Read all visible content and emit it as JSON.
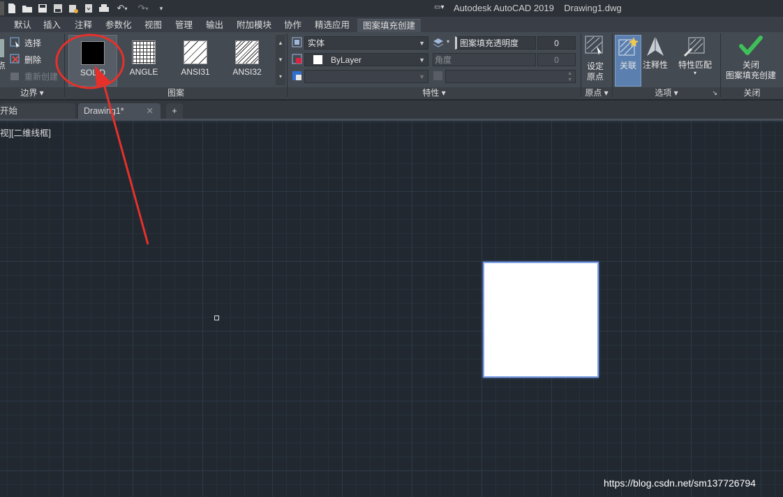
{
  "app_title": "Autodesk AutoCAD 2019    Drawing1.dwg",
  "ribbon_tabs": [
    "默认",
    "插入",
    "注释",
    "参数化",
    "视图",
    "管理",
    "输出",
    "附加模块",
    "协作",
    "精选应用",
    "图案填充创建"
  ],
  "boundary_panel": {
    "select_label": "选择",
    "delete_label": "删除",
    "recreate_label": "重新创建",
    "title": "边界",
    "pick_label_fragment": "点"
  },
  "pattern_panel": {
    "title": "图案",
    "patterns": [
      "SOLID",
      "ANGLE",
      "ANSI31",
      "ANSI32"
    ]
  },
  "properties_panel": {
    "title": "特性",
    "hatch_type": "实体",
    "color": "ByLayer",
    "transparency_label": "图案填充透明度",
    "transparency_value": "0",
    "angle_label": "角度",
    "angle_value": "0"
  },
  "origin_panel": {
    "set_origin_label_1": "设定",
    "set_origin_label_2": "原点",
    "title": "原点"
  },
  "options_panel": {
    "associative_label": "关联",
    "annotative_label": "注释性",
    "match_props_label": "特性匹配",
    "title": "选项"
  },
  "close_panel": {
    "close_label_1": "关闭",
    "close_label_2": "图案填充创建",
    "title": "关闭"
  },
  "doc_tabs": {
    "start": "开始",
    "drawing": "Drawing1*",
    "add": "+"
  },
  "viewport_label": "视][二维线框]",
  "watermark": "https://blog.csdn.net/sm137726794",
  "colors": {
    "annotation_red": "#e8302a",
    "accent_blue": "#7fa2e6",
    "check_green": "#3fbf5a"
  }
}
